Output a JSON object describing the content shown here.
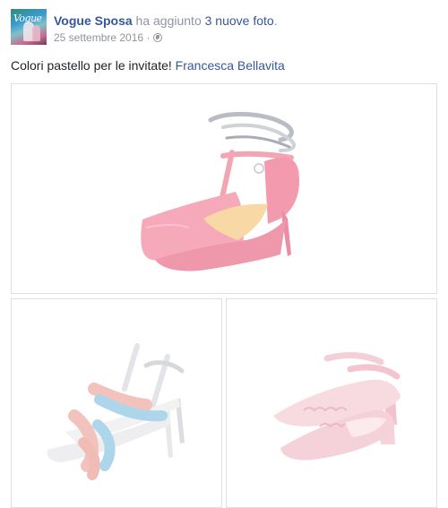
{
  "post": {
    "page_name": "Vogue Sposa",
    "action_text": " ha aggiunto ",
    "photos_link": "3 nuove foto",
    "action_end": ".",
    "date": "25 settembre 2016",
    "separator": " · ",
    "privacy_icon": "globe-icon",
    "caption_text": "Colori pastello per le invitate! ",
    "mention": "Francesca Bellavita",
    "colors": {
      "link": "#365899",
      "meta": "#90949c",
      "text": "#1d2129",
      "border": "#dddfe2"
    }
  },
  "photos": [
    {
      "subject": "pink pointed pump with silver ankle ties"
    },
    {
      "subject": "pink and light blue padded strappy sandal"
    },
    {
      "subject": "pale pink scalloped mary jane pump"
    }
  ]
}
